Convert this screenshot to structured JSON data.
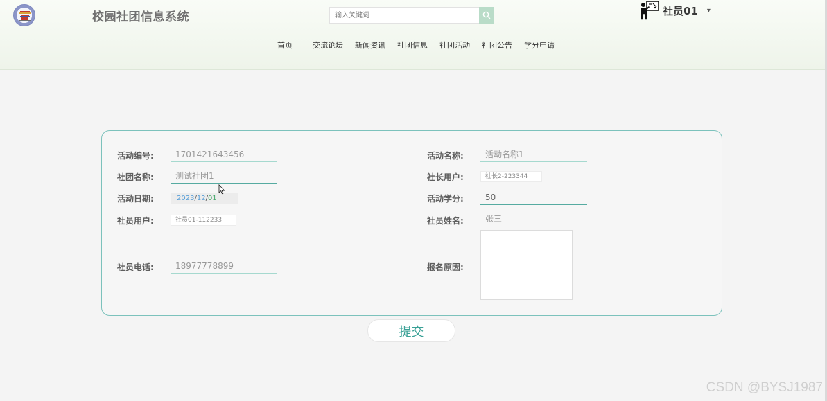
{
  "header": {
    "site_title": "校园社团信息系统",
    "search": {
      "placeholder": "输入关键词",
      "icon": "search-icon"
    },
    "user": {
      "name": "社员01",
      "caret": "▾"
    }
  },
  "nav": {
    "items": [
      "首页",
      "交流论坛",
      "新闻资讯",
      "社团信息",
      "社团活动",
      "社团公告",
      "学分申请"
    ]
  },
  "form": {
    "activity_no": {
      "label": "活动编号:",
      "value": "1701421643456"
    },
    "activity_name": {
      "label": "活动名称:",
      "value": "活动名称1"
    },
    "club_name": {
      "label": "社团名称:",
      "value": "测试社团1"
    },
    "president_user": {
      "label": "社长用户:",
      "value": "社长2-223344"
    },
    "activity_date": {
      "label": "活动日期:",
      "year": "2023",
      "month": "12",
      "day": "01",
      "sep": "/"
    },
    "activity_credit": {
      "label": "活动学分:",
      "value": "50"
    },
    "member_user": {
      "label": "社员用户:",
      "value": "社员01-112233"
    },
    "member_name": {
      "label": "社员姓名:",
      "value": "张三"
    },
    "member_phone": {
      "label": "社员电话:",
      "value": "18977778899"
    },
    "signup_reason": {
      "label": "报名原因:",
      "value": ""
    }
  },
  "submit_label": "提交",
  "watermark": "CSDN @BYSJ1987",
  "colors": {
    "accent": "#3aa196",
    "card_border": "#7cc2bc",
    "input_underline": "#a6d9cf",
    "header_bg": "#eef4ea"
  }
}
